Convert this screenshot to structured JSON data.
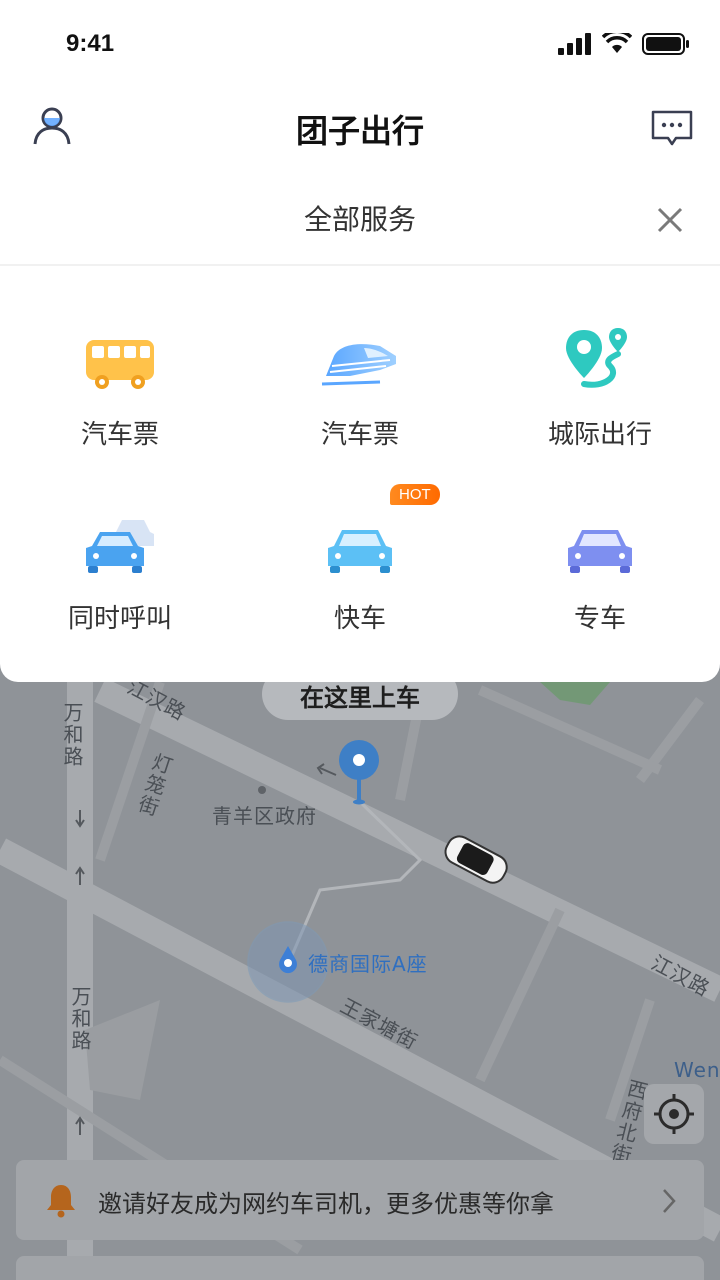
{
  "status_bar": {
    "time": "9:41"
  },
  "header": {
    "title": "团子出行"
  },
  "services": {
    "title": "全部服务",
    "items": [
      {
        "label": "汽车票",
        "icon": "bus-icon"
      },
      {
        "label": "汽车票",
        "icon": "train-icon"
      },
      {
        "label": "城际出行",
        "icon": "route-pin-icon"
      },
      {
        "label": "同时呼叫",
        "icon": "multi-car-icon"
      },
      {
        "label": "快车",
        "icon": "express-car-icon",
        "badge": "HOT"
      },
      {
        "label": "专车",
        "icon": "premium-car-icon"
      }
    ]
  },
  "map": {
    "pickup_label": "在这里上车",
    "labels": {
      "jianghan_road_1": "江汉路",
      "wanhe_road_1": "万和路",
      "denglong_street": "灯笼街",
      "qingyang_gov": "青羊区政府",
      "deshang_building": "德商国际A座",
      "wangjiatang_street": "王家塘街",
      "jianghan_road_2": "江汉路",
      "wanhe_road_2": "万和路",
      "xifu_north_street": "西府北街",
      "wens": "Wens"
    }
  },
  "invite": {
    "text": "邀请好友成为网约车司机，更多优惠等你拿"
  },
  "colors": {
    "accent_blue": "#3c8de0",
    "hot_orange": "#ff7a10",
    "bus_yellow": "#ffc24a",
    "teal": "#2ec9c0"
  }
}
